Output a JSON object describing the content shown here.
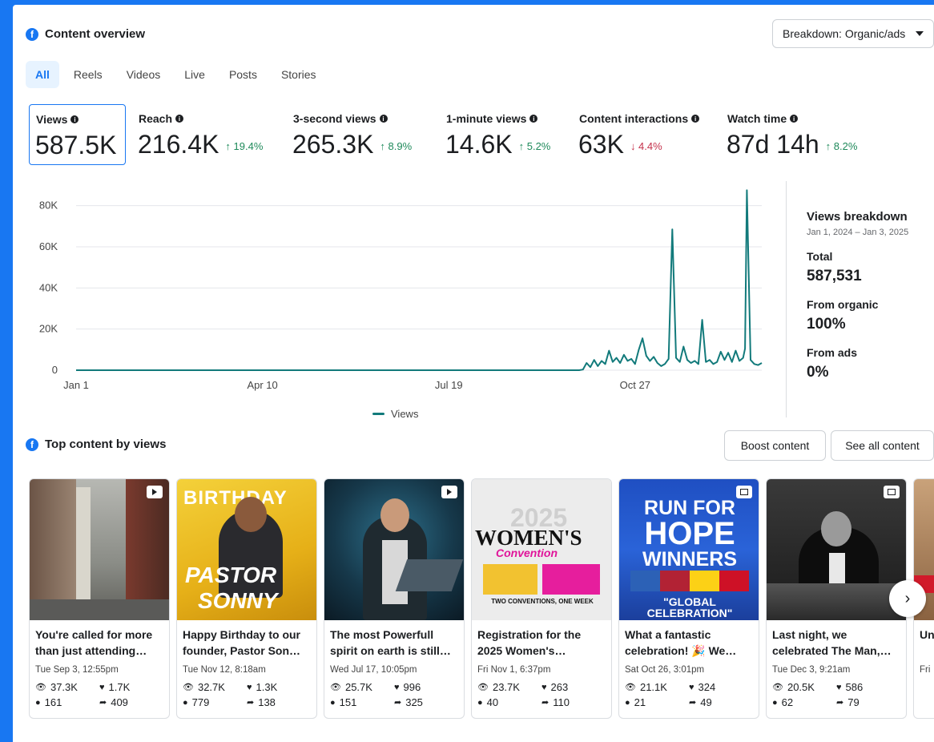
{
  "overview": {
    "title": "Content overview",
    "breakdown_button": "Breakdown: Organic/ads",
    "tabs": [
      "All",
      "Reels",
      "Videos",
      "Live",
      "Posts",
      "Stories"
    ],
    "active_tab": "All"
  },
  "metrics": [
    {
      "label": "Views",
      "value": "587.5K",
      "change": ""
    },
    {
      "label": "Reach",
      "value": "216.4K",
      "change": "↑ 19.4%"
    },
    {
      "label": "3-second views",
      "value": "265.3K",
      "change": "↑ 8.9%"
    },
    {
      "label": "1-minute views",
      "value": "14.6K",
      "change": "↑ 5.2%"
    },
    {
      "label": "Content interactions",
      "value": "63K",
      "change": "↓ 4.4%"
    },
    {
      "label": "Watch time",
      "value": "87d 14h",
      "change": "↑ 8.2%"
    }
  ],
  "chart_data": {
    "type": "line",
    "series": [
      {
        "name": "Views",
        "color": "#127a7b"
      }
    ],
    "x_ticks": [
      "Jan 1",
      "Apr 10",
      "Jul 19",
      "Oct 27"
    ],
    "y_ticks": [
      "0",
      "20K",
      "40K",
      "60K",
      "80K"
    ],
    "ylim": [
      0,
      90000
    ],
    "x_range_days": [
      0,
      368
    ],
    "points": [
      [
        0,
        0
      ],
      [
        100,
        0
      ],
      [
        200,
        0
      ],
      [
        270,
        0
      ],
      [
        272,
        300
      ],
      [
        274,
        3500
      ],
      [
        276,
        1500
      ],
      [
        278,
        5000
      ],
      [
        280,
        2000
      ],
      [
        282,
        4500
      ],
      [
        284,
        3000
      ],
      [
        286,
        9500
      ],
      [
        288,
        4000
      ],
      [
        290,
        6000
      ],
      [
        292,
        3500
      ],
      [
        294,
        7500
      ],
      [
        296,
        4500
      ],
      [
        298,
        5500
      ],
      [
        300,
        3000
      ],
      [
        302,
        10000
      ],
      [
        304,
        15500
      ],
      [
        306,
        7000
      ],
      [
        308,
        4500
      ],
      [
        310,
        6500
      ],
      [
        312,
        3500
      ],
      [
        314,
        2000
      ],
      [
        316,
        3000
      ],
      [
        318,
        5500
      ],
      [
        320,
        68500
      ],
      [
        322,
        6000
      ],
      [
        324,
        4000
      ],
      [
        326,
        11500
      ],
      [
        328,
        5000
      ],
      [
        330,
        3500
      ],
      [
        332,
        4500
      ],
      [
        334,
        3000
      ],
      [
        336,
        24500
      ],
      [
        338,
        4000
      ],
      [
        340,
        5000
      ],
      [
        342,
        3000
      ],
      [
        344,
        4000
      ],
      [
        346,
        9000
      ],
      [
        348,
        5000
      ],
      [
        350,
        8500
      ],
      [
        352,
        4000
      ],
      [
        354,
        9500
      ],
      [
        356,
        4500
      ],
      [
        358,
        6000
      ],
      [
        359,
        10500
      ],
      [
        360,
        87500
      ],
      [
        362,
        5000
      ],
      [
        364,
        3000
      ],
      [
        366,
        2500
      ],
      [
        368,
        3500
      ]
    ]
  },
  "views_breakdown": {
    "title": "Views breakdown",
    "date_range": "Jan 1, 2024 – Jan 3, 2025",
    "total_label": "Total",
    "total_value": "587,531",
    "organic_label": "From organic",
    "organic_value": "100%",
    "ads_label": "From ads",
    "ads_value": "0%"
  },
  "top_content": {
    "title": "Top content by views",
    "boost_button": "Boost content",
    "see_all_button": "See all content",
    "cards": [
      {
        "title": "You're called for more than just attending…",
        "date": "Tue Sep 3, 12:55pm",
        "views": "37.3K",
        "reactions": "1.7K",
        "comments": "161",
        "shares": "409"
      },
      {
        "title": "Happy Birthday to our founder, Pastor Son…",
        "date": "Tue Nov 12, 8:18am",
        "views": "32.7K",
        "reactions": "1.3K",
        "comments": "779",
        "shares": "138",
        "thumb_text": [
          "BIRTHDAY",
          "PASTOR",
          "SONNY"
        ]
      },
      {
        "title": "The most Powerfull spirit on earth is still…",
        "date": "Wed Jul 17, 10:05pm",
        "views": "25.7K",
        "reactions": "996",
        "comments": "151",
        "shares": "325"
      },
      {
        "title": "Registration for the 2025 Women's…",
        "date": "Fri Nov 1, 6:37pm",
        "views": "23.7K",
        "reactions": "263",
        "comments": "40",
        "shares": "110",
        "thumb_text": [
          "2025",
          "WOMEN'S",
          "Convention",
          "TWO CONVENTIONS, ONE WEEK"
        ]
      },
      {
        "title": "What a fantastic celebration! 🎉 We…",
        "date": "Sat Oct 26, 3:01pm",
        "views": "21.1K",
        "reactions": "324",
        "comments": "21",
        "shares": "49",
        "thumb_text": [
          "RUN FOR",
          "HOPE",
          "WINNERS",
          "\"GLOBAL",
          "CELEBRATION\""
        ]
      },
      {
        "title": "Last night, we celebrated The Man,…",
        "date": "Tue Dec 3, 9:21am",
        "views": "20.5K",
        "reactions": "586",
        "comments": "62",
        "shares": "79"
      },
      {
        "title": "Un Mi…",
        "date": "Fri",
        "views": "",
        "reactions": "",
        "comments": "",
        "shares": ""
      }
    ]
  },
  "colors": {
    "brand": "#1877f2",
    "series": "#127a7b",
    "up": "#1f8a5b",
    "down": "#c4314b"
  },
  "icons": {
    "views": "eye-icon",
    "reactions": "heart-icon",
    "comments": "comment-icon",
    "shares": "share-icon",
    "next": "chevron-right-icon"
  }
}
